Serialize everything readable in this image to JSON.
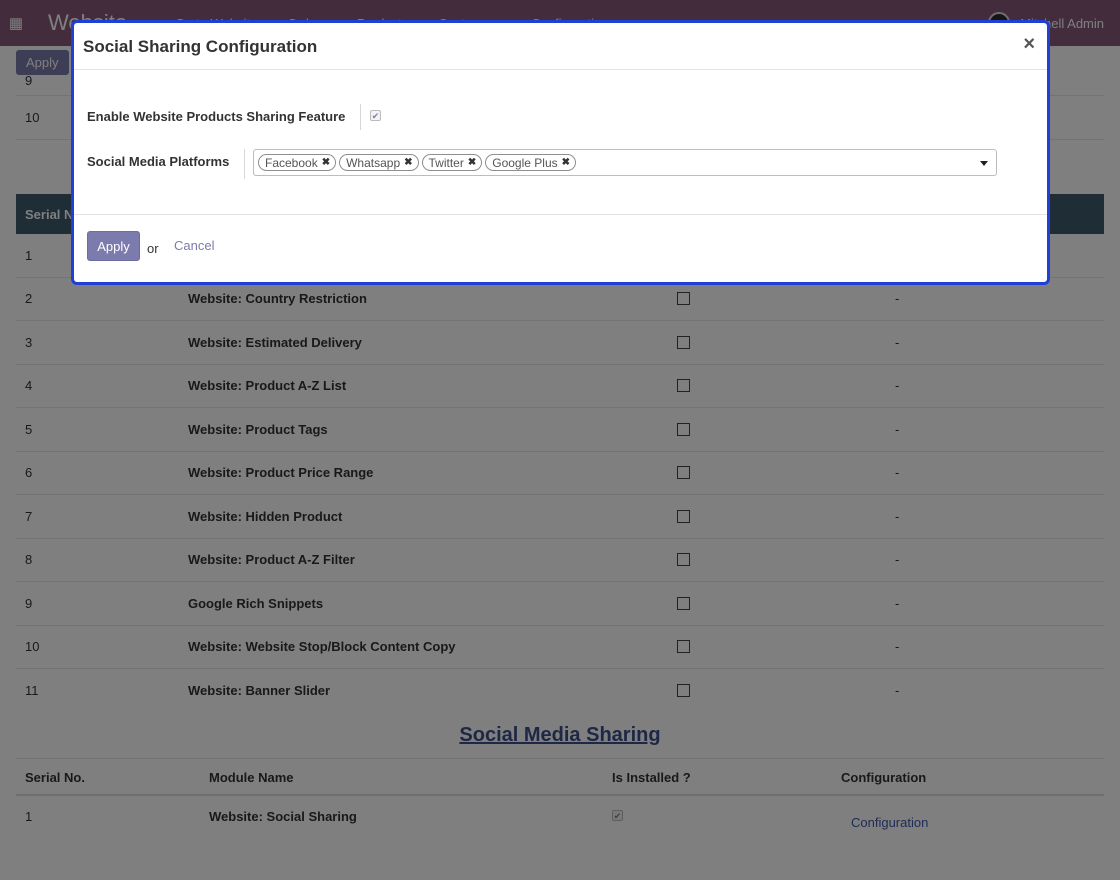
{
  "navbar": {
    "brand": "Website",
    "menu": [
      "Go to Website",
      "Orders",
      "Products",
      "Customers",
      "Configuration"
    ],
    "user": "Mitchell Admin"
  },
  "background": {
    "apply_label": "Apply",
    "top_rows": [
      "9",
      "10"
    ],
    "table_header_serial": "Serial No.",
    "modules": [
      {
        "serial": "1",
        "name": "",
        "config": ""
      },
      {
        "serial": "2",
        "name": "Website: Country Restriction",
        "config": "-"
      },
      {
        "serial": "3",
        "name": "Website: Estimated Delivery",
        "config": "-"
      },
      {
        "serial": "4",
        "name": "Website: Product A-Z List",
        "config": "-"
      },
      {
        "serial": "5",
        "name": "Website: Product Tags",
        "config": "-"
      },
      {
        "serial": "6",
        "name": "Website: Product Price Range",
        "config": "-"
      },
      {
        "serial": "7",
        "name": "Website: Hidden Product",
        "config": "-"
      },
      {
        "serial": "8",
        "name": "Website: Product A-Z Filter",
        "config": "-"
      },
      {
        "serial": "9",
        "name": "Google Rich Snippets",
        "config": "-"
      },
      {
        "serial": "10",
        "name": "Website: Website Stop/Block Content Copy",
        "config": "-"
      },
      {
        "serial": "11",
        "name": "Website: Banner Slider",
        "config": "-"
      }
    ],
    "section_title": "Social Media Sharing",
    "social_headers": {
      "serial": "Serial No.",
      "module": "Module Name",
      "installed": "Is Installed ?",
      "config": "Configuration"
    },
    "social_row": {
      "serial": "1",
      "module": "Website: Social Sharing",
      "installed": true,
      "config": "Configuration"
    }
  },
  "dialog": {
    "title": "Social Sharing Configuration",
    "close_glyph": "×",
    "field1_label": "Enable Website Products Sharing Feature",
    "field1_checked": true,
    "field2_label": "Social Media Platforms",
    "platforms": [
      "Facebook",
      "Whatsapp",
      "Twitter",
      "Google Plus"
    ],
    "tag_remove_glyph": "✖",
    "apply_label": "Apply",
    "or_text": "or",
    "cancel_label": "Cancel"
  },
  "colors": {
    "navbar": "#875a7b",
    "primary_button": "#7c7bad",
    "dialog_border": "#1f3fd6",
    "table_header": "#3d5a6c",
    "link": "#3f5aa9"
  },
  "icons": {
    "apps": "grid-icon",
    "close": "close-icon",
    "tag_remove": "remove-icon",
    "dropdown": "caret-down-icon",
    "checkbox": "check-icon"
  }
}
